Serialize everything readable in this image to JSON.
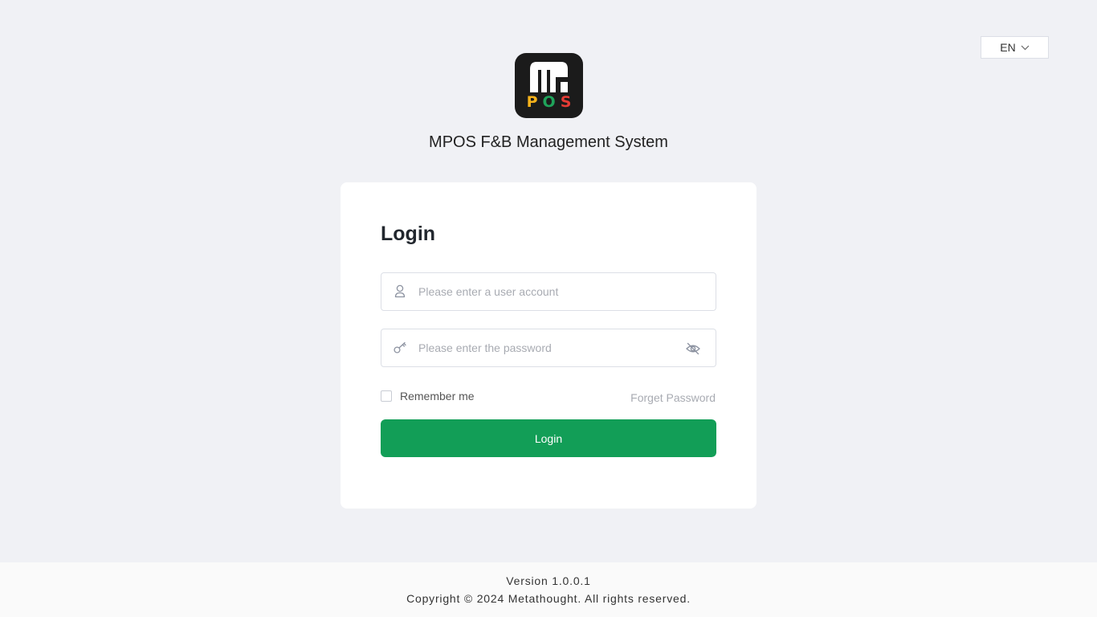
{
  "header": {
    "language": {
      "value": "EN",
      "icon": "chevron-down-icon"
    }
  },
  "brand": {
    "logo_letters": [
      "P",
      "O",
      "S"
    ],
    "logo_colors": {
      "background": "#1b1b1b",
      "P": "#f5b21b",
      "O": "#1fa35a",
      "S": "#e53b35",
      "mark": "#ffffff"
    },
    "app_title": "MPOS F&B Management System"
  },
  "login": {
    "title": "Login",
    "account": {
      "placeholder": "Please enter a user account",
      "value": "",
      "icon": "user-icon"
    },
    "password": {
      "placeholder": "Please enter the password",
      "value": "",
      "icon": "key-icon",
      "toggle_icon": "eye-off-icon"
    },
    "remember_label": "Remember me",
    "remember_checked": false,
    "forget_label": "Forget Password",
    "submit_label": "Login",
    "accent_color": "#129e57"
  },
  "footer": {
    "version": "Version 1.0.0.1",
    "copyright": "Copyright © 2024 Metathought. All rights reserved."
  }
}
